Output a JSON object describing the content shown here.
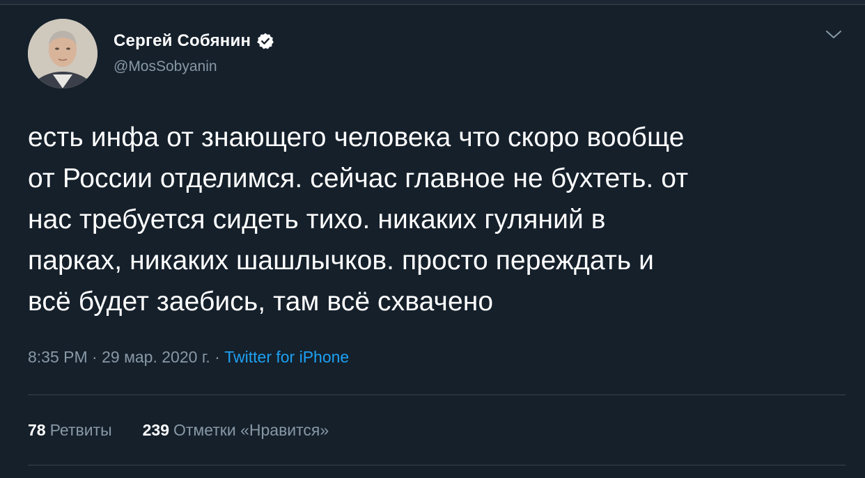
{
  "author": {
    "display_name": "Сергей Собянин",
    "handle": "@MosSobyanin",
    "verified": true
  },
  "tweet": {
    "lines": [
      "есть инфа от знающего человека что скоро вообще",
      "от России отделимся. сейчас главное не бухтеть. от",
      "нас требуется сидеть тихо. никаких гуляний в",
      "парках, никаких шашлычков. просто переждать и",
      "всё будет заебись, там всё схвачено"
    ],
    "time": "8:35 PM",
    "date": "29 мар. 2020 г.",
    "separator": " · ",
    "source": "Twitter for iPhone"
  },
  "stats": {
    "retweets_count": "78",
    "retweets_label": "Ретвиты",
    "likes_count": "239",
    "likes_label": "Отметки «Нравится»"
  },
  "icons": {
    "verified": "verified-badge-icon",
    "caret": "chevron-down-icon"
  },
  "colors": {
    "background": "#15202b",
    "text": "#ffffff",
    "secondary": "#8899a6",
    "link": "#1da1f2",
    "divider": "#38444d"
  }
}
